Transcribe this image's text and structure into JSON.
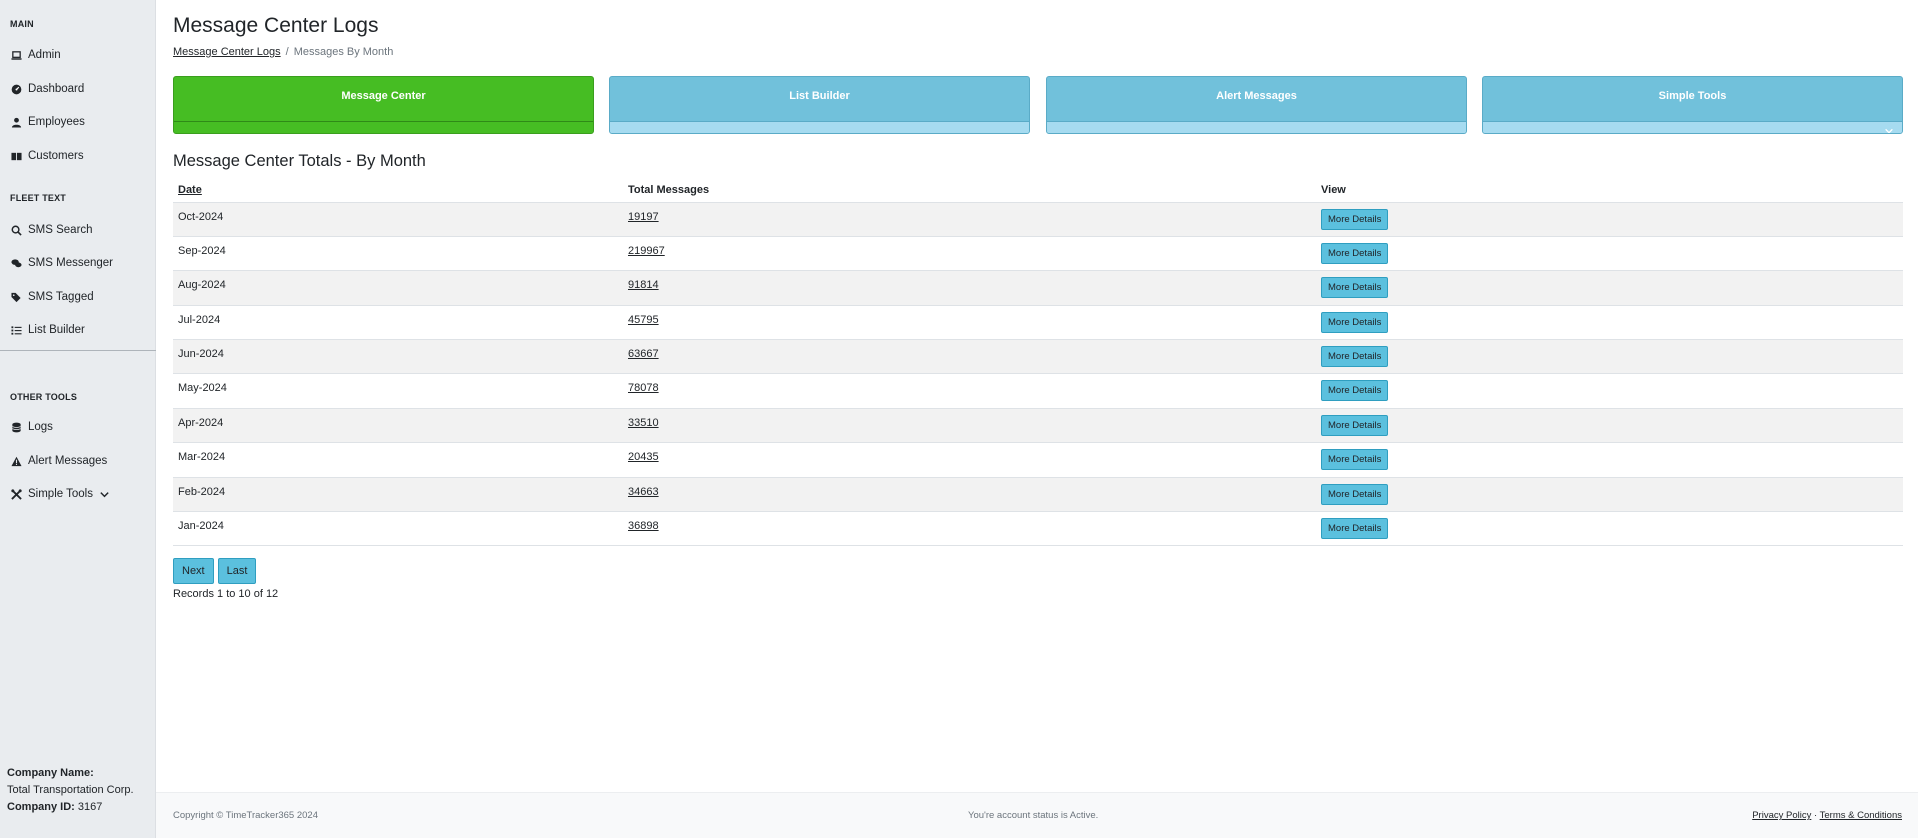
{
  "sidebar": {
    "sections": [
      {
        "title": "MAIN",
        "items": [
          {
            "label": "Admin",
            "icon": "laptop-icon"
          },
          {
            "label": "Dashboard",
            "icon": "gauge-icon"
          },
          {
            "label": "Employees",
            "icon": "user-icon"
          },
          {
            "label": "Customers",
            "icon": "book-open-icon"
          }
        ]
      },
      {
        "title": "FLEET TEXT",
        "items": [
          {
            "label": "SMS Search",
            "icon": "search-icon"
          },
          {
            "label": "SMS Messenger",
            "icon": "comments-icon"
          },
          {
            "label": "SMS Tagged",
            "icon": "tags-icon"
          },
          {
            "label": "List Builder",
            "icon": "list-icon"
          }
        ]
      },
      {
        "title": "OTHER TOOLS",
        "items": [
          {
            "label": "Logs",
            "icon": "database-icon"
          },
          {
            "label": "Alert Messages",
            "icon": "warning-icon"
          },
          {
            "label": "Simple Tools",
            "icon": "tools-icon"
          }
        ]
      }
    ],
    "company": {
      "name_label": "Company Name:",
      "name": "Total Transportation Corp.",
      "id_label": "Company ID:",
      "id": "3167"
    }
  },
  "header": {
    "title": "Message Center Logs",
    "breadcrumb": {
      "link": "Message Center Logs",
      "separator": "/",
      "current": "Messages By Month"
    }
  },
  "cards": [
    {
      "label": "Message Center",
      "color": "#46bd23"
    },
    {
      "label": "List Builder",
      "color": "#71c1db"
    },
    {
      "label": "Alert Messages",
      "color": "#71c1db"
    },
    {
      "label": "Simple Tools",
      "color": "#71c1db"
    }
  ],
  "section_title": "Message Center Totals - By Month",
  "table": {
    "columns": {
      "date": "Date",
      "total": "Total Messages",
      "view": "View"
    },
    "button_label": "More Details",
    "rows": [
      {
        "date": "Oct-2024",
        "total": "19197"
      },
      {
        "date": "Sep-2024",
        "total": "219967"
      },
      {
        "date": "Aug-2024",
        "total": "91814"
      },
      {
        "date": "Jul-2024",
        "total": "45795"
      },
      {
        "date": "Jun-2024",
        "total": "63667"
      },
      {
        "date": "May-2024",
        "total": "78078"
      },
      {
        "date": "Apr-2024",
        "total": "33510"
      },
      {
        "date": "Mar-2024",
        "total": "20435"
      },
      {
        "date": "Feb-2024",
        "total": "34663"
      },
      {
        "date": "Jan-2024",
        "total": "36898"
      }
    ]
  },
  "pager": {
    "next": "Next",
    "last": "Last",
    "records": "Records 1 to 10 of 12"
  },
  "footer": {
    "copyright": "Copyright © TimeTracker365 2024",
    "status": "You're account status is Active.",
    "privacy": "Privacy Policy",
    "link_separator": "·",
    "terms": "Terms & Conditions"
  }
}
